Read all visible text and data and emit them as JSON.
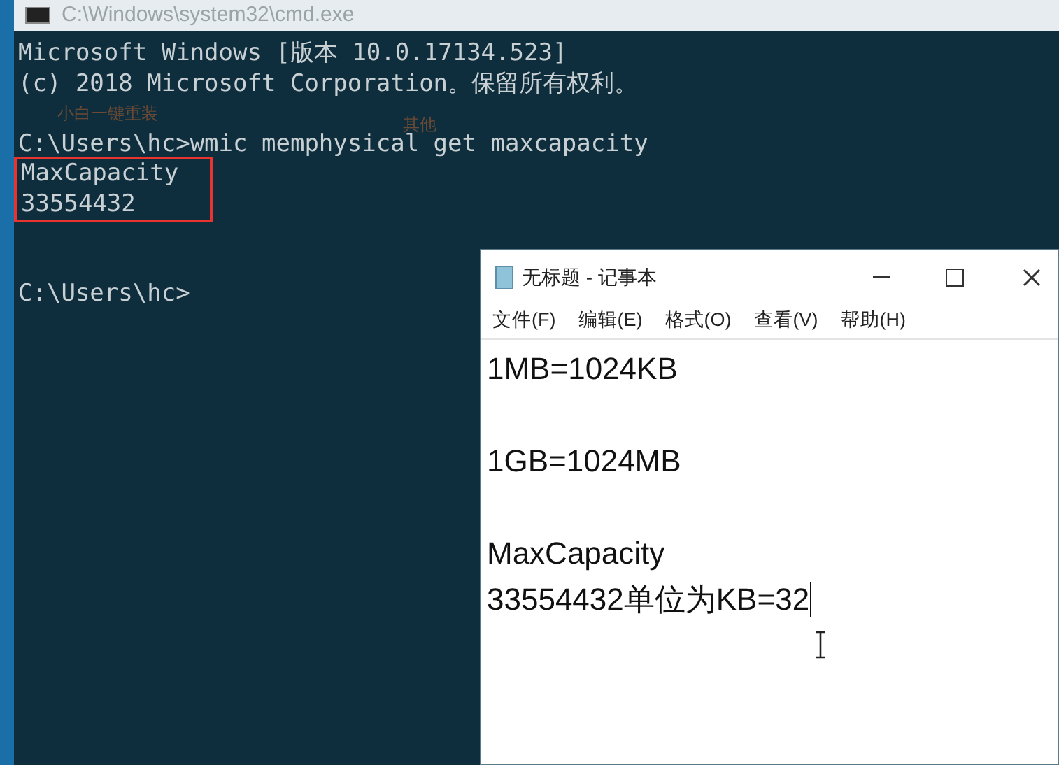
{
  "cmd": {
    "title": "C:\\Windows\\system32\\cmd.exe",
    "header": [
      "Microsoft Windows [版本 10.0.17134.523]",
      "(c) 2018 Microsoft Corporation。保留所有权利。"
    ],
    "desktop_labels": [
      "小白一键重装",
      "其他"
    ],
    "command": "C:\\Users\\hc>wmic memphysical get maxcapacity",
    "output": {
      "boxed": true,
      "lines": [
        "MaxCapacity",
        "33554432"
      ]
    },
    "prompt": "C:\\Users\\hc>"
  },
  "notepad": {
    "title": "无标题 - 记事本",
    "menu": [
      "文件(F)",
      "编辑(E)",
      "格式(O)",
      "查看(V)",
      "帮助(H)"
    ],
    "paragraphs": [
      [
        "1MB=1024KB"
      ],
      [
        "1GB=1024MB"
      ],
      [
        "MaxCapacity",
        "33554432单位为KB=32"
      ]
    ]
  }
}
